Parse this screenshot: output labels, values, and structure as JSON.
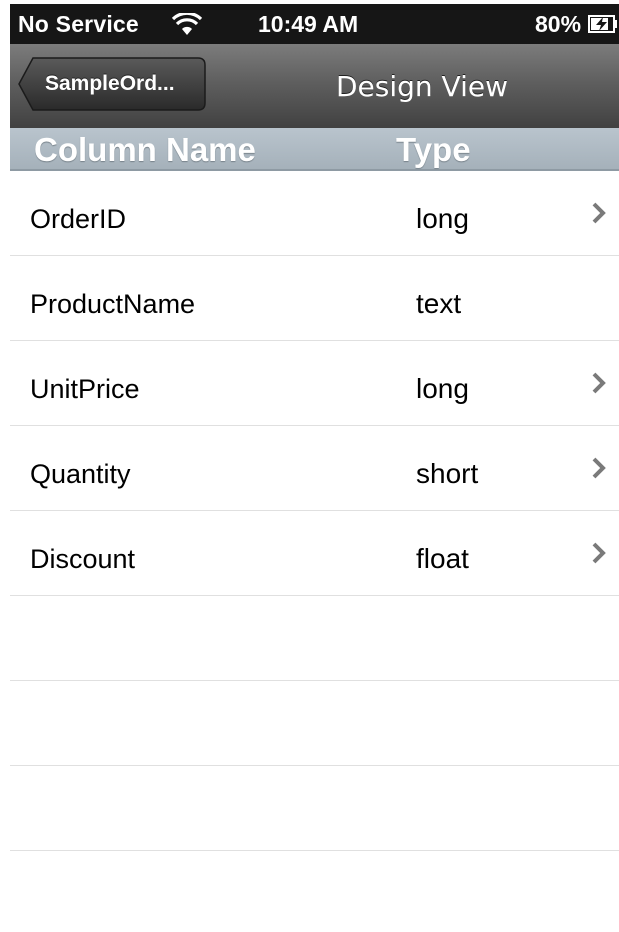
{
  "status_bar": {
    "carrier": "No Service",
    "time": "10:49 AM",
    "battery": "80%",
    "wifi_icon": "wifi-icon",
    "battery_icon": "battery-charging-icon"
  },
  "nav": {
    "back_label": "SampleOrd...",
    "title": "Design View"
  },
  "table": {
    "headers": {
      "column_name": "Column Name",
      "type": "Type"
    },
    "rows": [
      {
        "name": "OrderID",
        "type": "long",
        "has_chevron": true
      },
      {
        "name": "ProductName",
        "type": "text",
        "has_chevron": false
      },
      {
        "name": "UnitPrice",
        "type": "long",
        "has_chevron": true
      },
      {
        "name": "Quantity",
        "type": "short",
        "has_chevron": true
      },
      {
        "name": "Discount",
        "type": "float",
        "has_chevron": true
      }
    ]
  },
  "colors": {
    "status_bar_bg": "#161616",
    "nav_bar_gradient_top": "#7c7c7c",
    "nav_bar_gradient_bottom": "#414141",
    "header_bg": "#b0bcc5",
    "separator": "#e0e0e0",
    "chevron": "#7a7a7a"
  }
}
